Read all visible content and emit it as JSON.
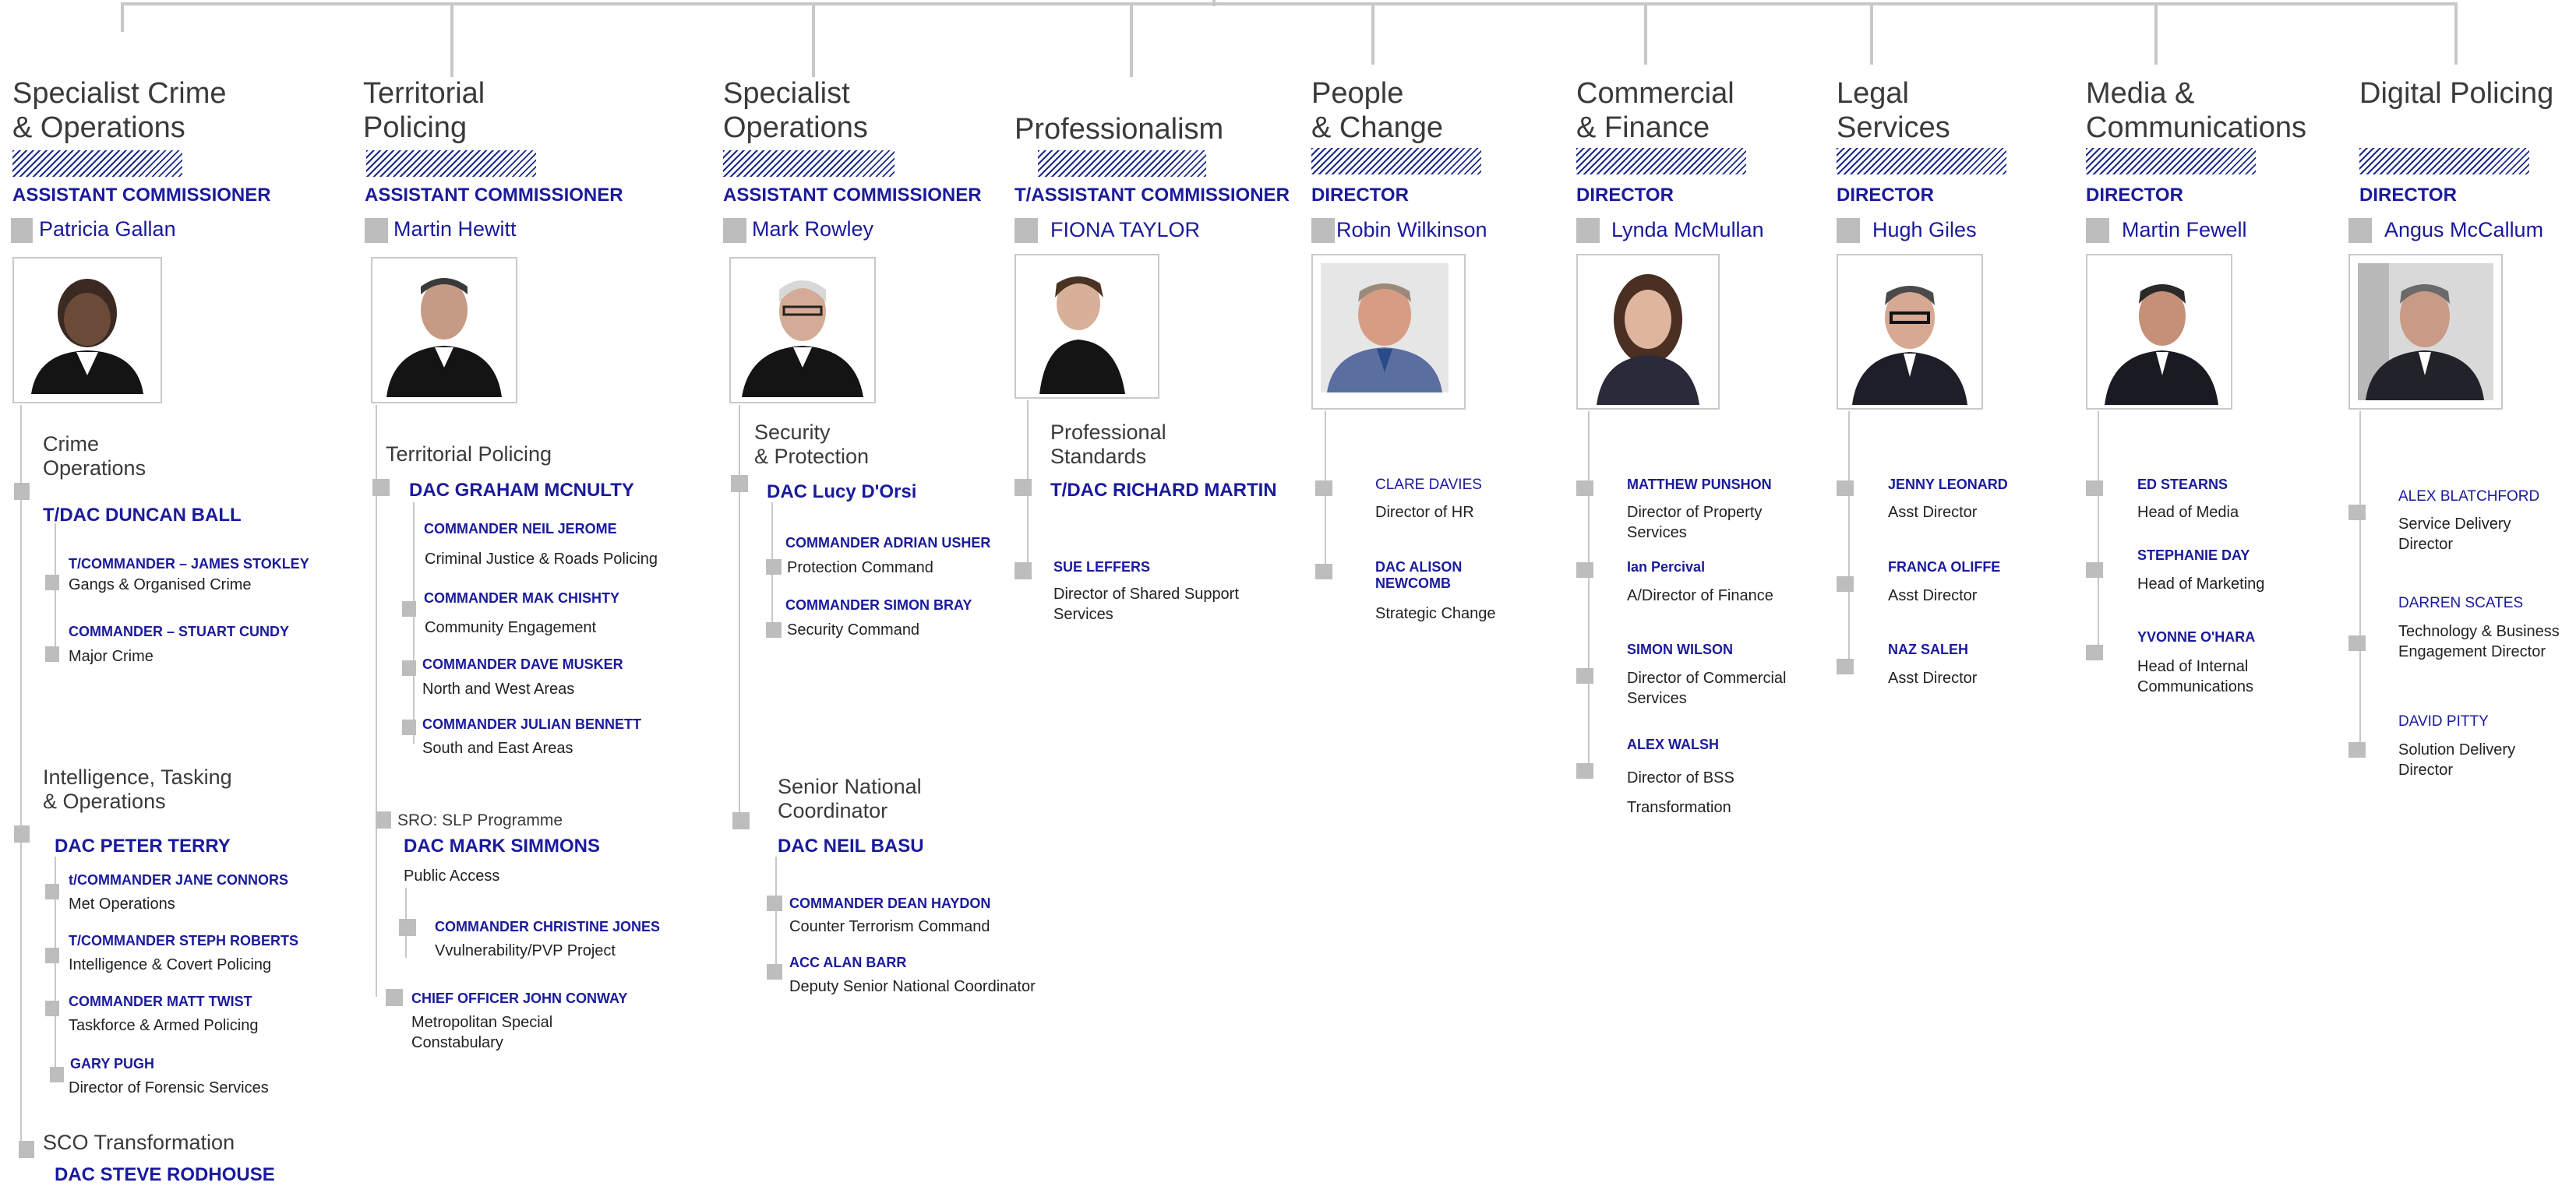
{
  "columns": [
    {
      "id": "sco",
      "title": [
        "Specialist Crime",
        "& Operations"
      ],
      "rank": "ASSISTANT COMMISSIONER",
      "leader": "Patricia Gallan",
      "groups": [
        {
          "name": [
            "Crime",
            "Operations"
          ],
          "head": "T/DAC DUNCAN BALL",
          "members": [
            {
              "name": "T/COMMANDER – JAMES STOKLEY",
              "role": "Gangs & Organised Crime"
            },
            {
              "name": "COMMANDER – STUART CUNDY",
              "role": "Major Crime"
            }
          ]
        },
        {
          "name": [
            "Intelligence, Tasking",
            "& Operations"
          ],
          "head": "DAC PETER TERRY",
          "members": [
            {
              "name": "t/COMMANDER JANE CONNORS",
              "role": "Met Operations"
            },
            {
              "name": "T/COMMANDER STEPH ROBERTS",
              "role": "Intelligence & Covert Policing"
            },
            {
              "name": "COMMANDER MATT TWIST",
              "role": "Taskforce & Armed Policing"
            },
            {
              "name": "GARY PUGH",
              "role": "Director of Forensic Services"
            }
          ]
        },
        {
          "name": [
            "SCO Transformation"
          ],
          "head": "DAC STEVE RODHOUSE",
          "members": []
        }
      ]
    },
    {
      "id": "tp",
      "title": [
        "Territorial",
        "Policing"
      ],
      "rank": "ASSISTANT COMMISSIONER",
      "leader": "Martin Hewitt",
      "groups": [
        {
          "name": [
            "Territorial Policing"
          ],
          "head": "DAC GRAHAM MCNULTY",
          "members": [
            {
              "name": "COMMANDER NEIL JEROME",
              "role": "Criminal Justice & Roads Policing"
            },
            {
              "name": "COMMANDER MAK CHISHTY",
              "role": "Community Engagement"
            },
            {
              "name": "COMMANDER DAVE MUSKER",
              "role": "North and West  Areas"
            },
            {
              "name": "COMMANDER JULIAN BENNETT",
              "role": "South and East Areas"
            }
          ]
        },
        {
          "name": [
            "SRO: SLP Programme"
          ],
          "head": "DAC MARK SIMMONS",
          "head_role": "Public Access",
          "members": [
            {
              "name": "COMMANDER CHRISTINE JONES",
              "role": "Vvulnerability/PVP Project"
            },
            {
              "name": "CHIEF OFFICER JOHN CONWAY",
              "role": "Metropolitan Special Constabulary"
            }
          ]
        }
      ]
    },
    {
      "id": "so",
      "title": [
        "Specialist",
        "Operations"
      ],
      "rank": "ASSISTANT COMMISSIONER",
      "leader": "Mark Rowley",
      "groups": [
        {
          "name": [
            "Security",
            "& Protection"
          ],
          "head": "DAC Lucy D'Orsi",
          "members": [
            {
              "name": "COMMANDER ADRIAN USHER",
              "role": "Protection Command"
            },
            {
              "name": "COMMANDER SIMON BRAY",
              "role": "Security Command"
            }
          ]
        },
        {
          "name": [
            "Senior National",
            "Coordinator"
          ],
          "head": "DAC NEIL BASU",
          "members": [
            {
              "name": "COMMANDER DEAN HAYDON",
              "role": "Counter Terrorism Command"
            },
            {
              "name": "ACC ALAN BARR",
              "role": "Deputy Senior National Coordinator"
            }
          ]
        }
      ]
    },
    {
      "id": "prof",
      "title": [
        "Professionalism"
      ],
      "rank": "T/ASSISTANT COMMISSIONER",
      "leader": "FIONA TAYLOR",
      "groups": [
        {
          "name": [
            "Professional",
            "Standards"
          ],
          "head": "T/DAC RICHARD MARTIN",
          "members": [
            {
              "name": "SUE LEFFERS",
              "role": "Director of Shared Support Services"
            }
          ]
        }
      ]
    },
    {
      "id": "people",
      "title": [
        "People",
        "& Change"
      ],
      "rank": "DIRECTOR",
      "leader": "Robin Wilkinson",
      "members": [
        {
          "name": "CLARE DAVIES",
          "role": "Director of HR"
        },
        {
          "name": "DAC ALISON NEWCOMB",
          "role": "Strategic Change"
        }
      ]
    },
    {
      "id": "finance",
      "title": [
        "Commercial",
        "& Finance"
      ],
      "rank": "DIRECTOR",
      "leader": "Lynda McMullan",
      "members": [
        {
          "name": "MATTHEW PUNSHON",
          "role": "Director of Property Services"
        },
        {
          "name": "Ian Percival",
          "role": "A/Director of Finance"
        },
        {
          "name": "SIMON WILSON",
          "role": "Director of Commercial Services"
        },
        {
          "name": "ALEX WALSH",
          "role": "Director of BSS Transformation"
        }
      ]
    },
    {
      "id": "legal",
      "title": [
        "Legal",
        "Services"
      ],
      "rank": "DIRECTOR",
      "leader": "Hugh Giles",
      "members": [
        {
          "name": "JENNY LEONARD",
          "role": "Asst Director"
        },
        {
          "name": "FRANCA OLIFFE",
          "role": "Asst Director"
        },
        {
          "name": "NAZ SALEH",
          "role": "Asst Director"
        }
      ]
    },
    {
      "id": "media",
      "title": [
        "Media &",
        "Communications"
      ],
      "rank": "DIRECTOR",
      "leader": "Martin Fewell",
      "members": [
        {
          "name": "ED STEARNS",
          "role": "Head of Media"
        },
        {
          "name": "STEPHANIE DAY",
          "role": "Head of Marketing"
        },
        {
          "name": "YVONNE O'HARA",
          "role": "Head of Internal Communications"
        }
      ]
    },
    {
      "id": "digital",
      "title": [
        "Digital Policing"
      ],
      "rank": "DIRECTOR",
      "leader": "Angus McCallum",
      "members": [
        {
          "name": "ALEX BLATCHFORD",
          "role": "Service Delivery Director"
        },
        {
          "name": "DARREN SCATES",
          "role": "Technology & Business Engagement Director"
        },
        {
          "name": "DAVID PITTY",
          "role": "Solution Delivery Director"
        }
      ]
    }
  ],
  "colors": {
    "accent_navy": "#1a1a9c",
    "hatch": "#1a2a8a",
    "connector": "#c8c8c8",
    "bullet": "#bdbdbd",
    "heading_text": "#3a3a3a"
  }
}
